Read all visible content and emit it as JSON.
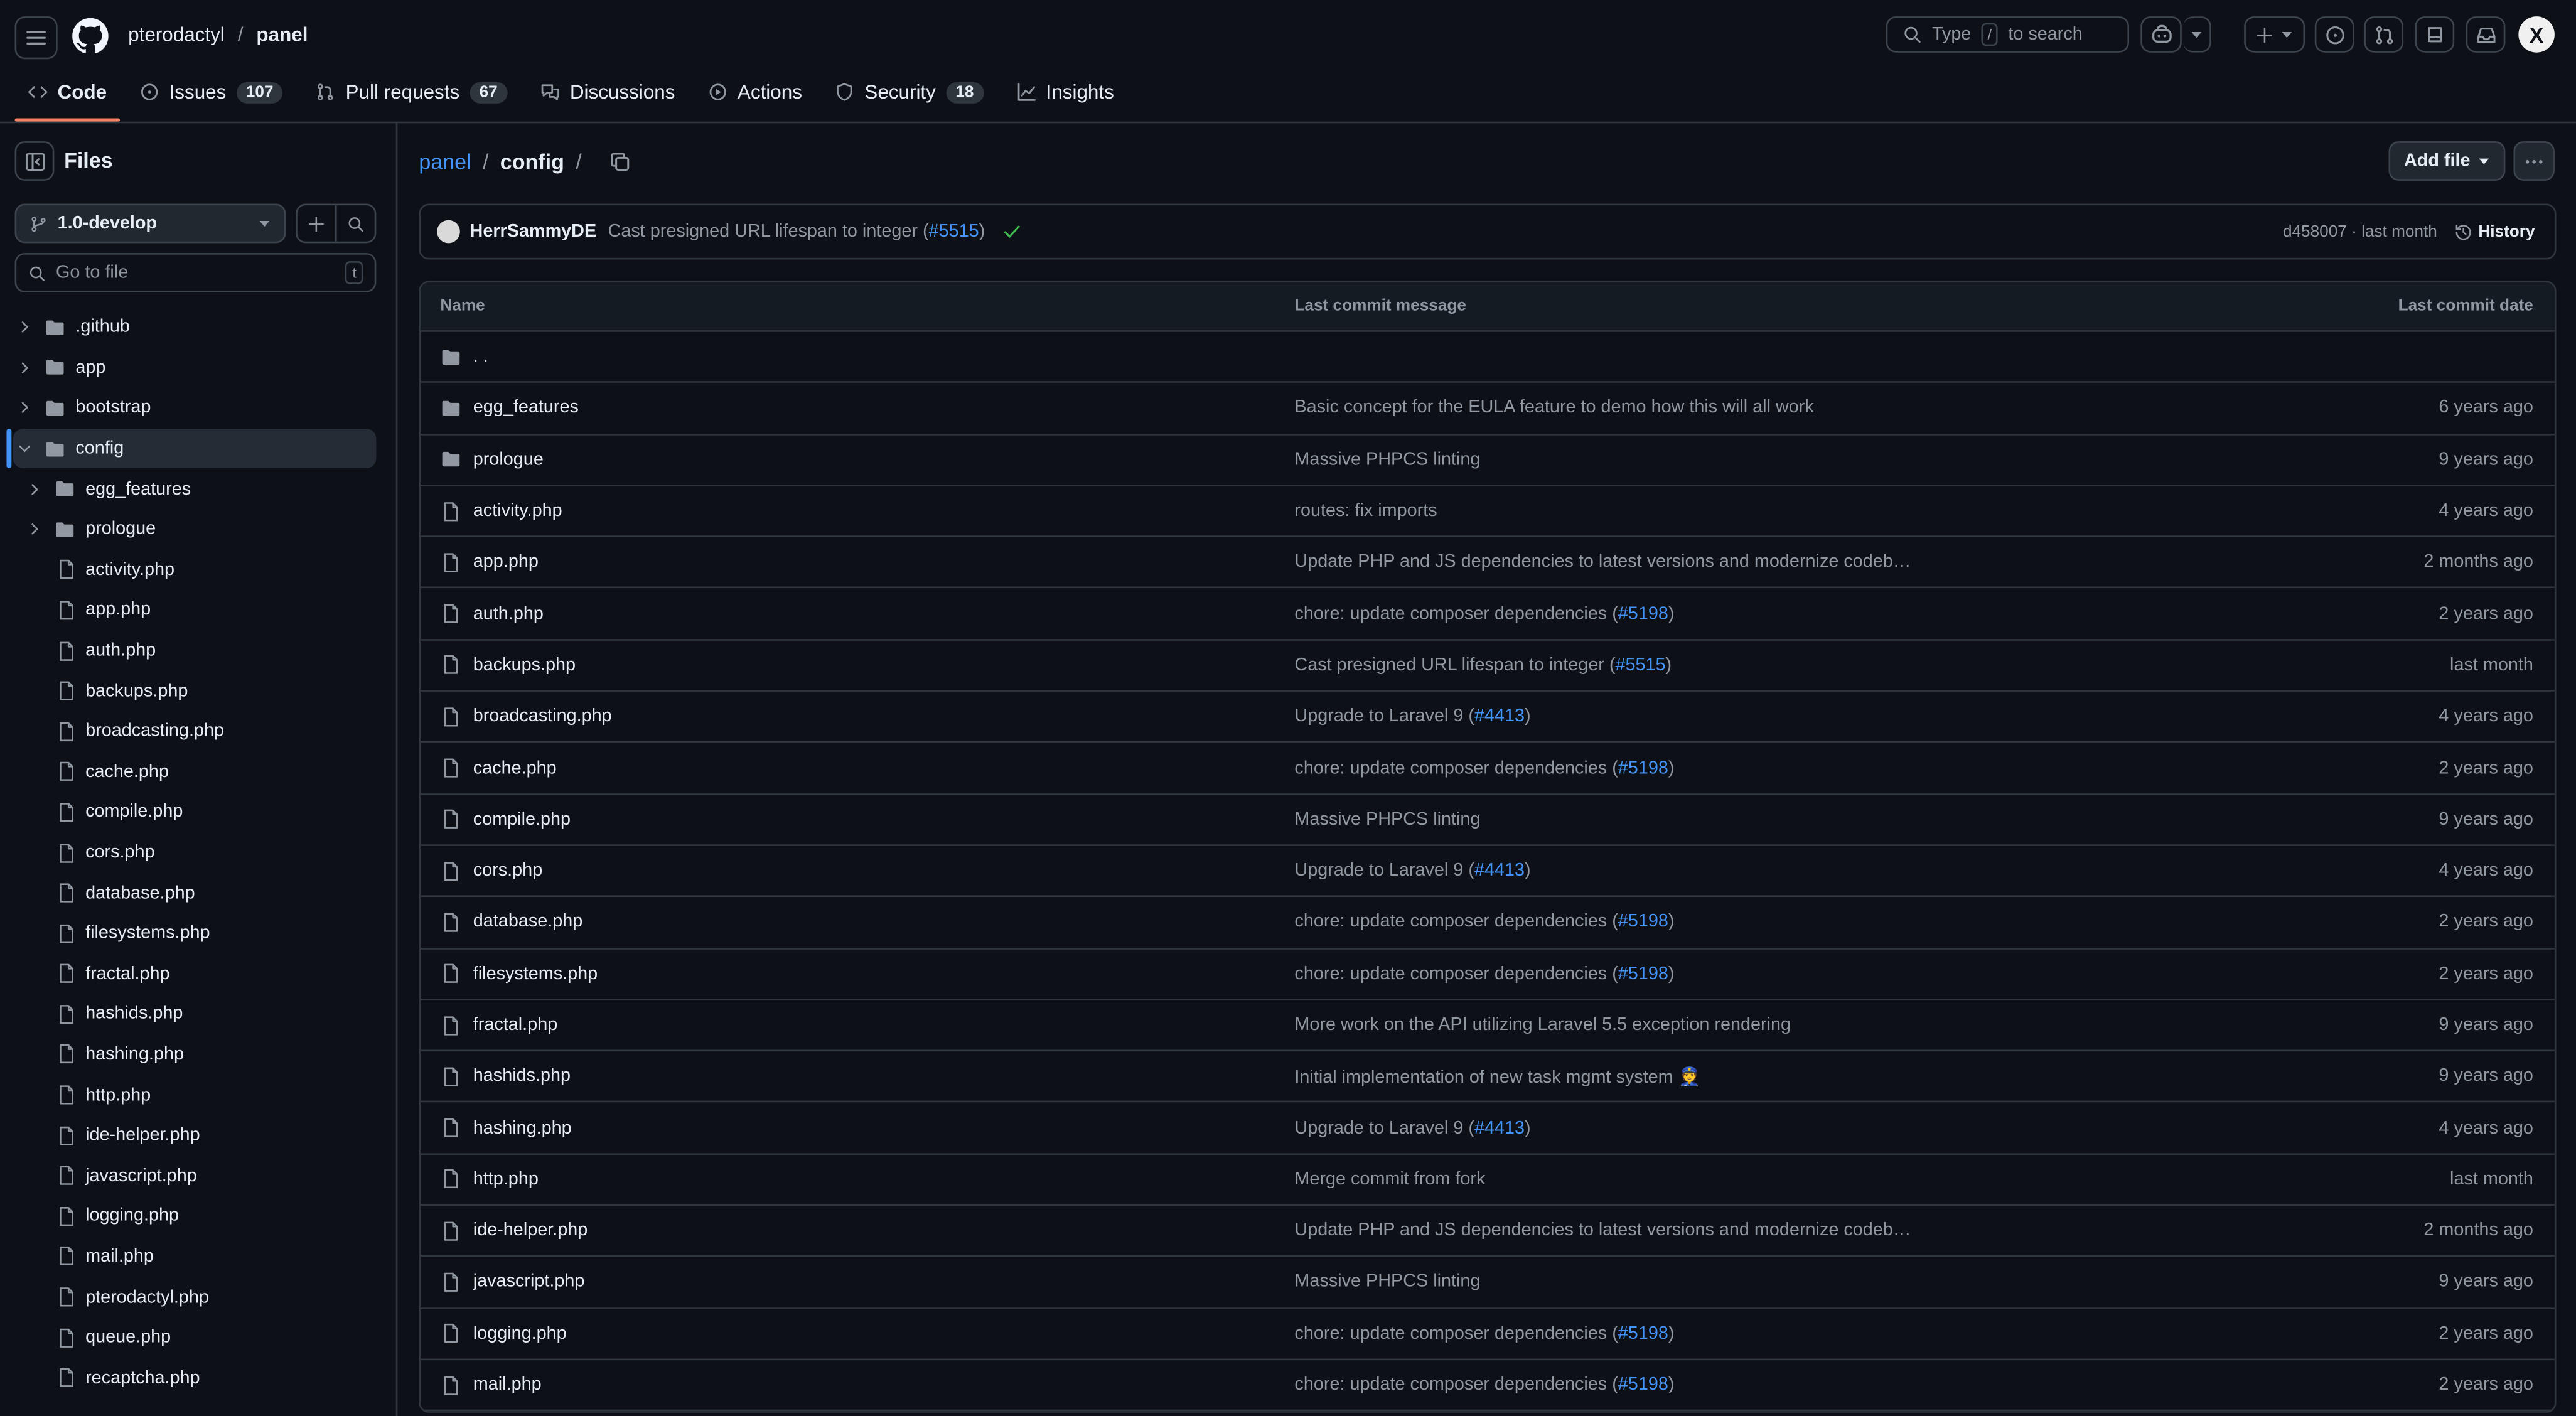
{
  "header": {
    "owner": "pterodactyl",
    "repo": "panel",
    "search_prefix": "Type",
    "search_key": "/",
    "search_suffix": "to search",
    "avatar_letter": "X"
  },
  "repo_tabs": [
    {
      "label": "Code",
      "count": ""
    },
    {
      "label": "Issues",
      "count": "107"
    },
    {
      "label": "Pull requests",
      "count": "67"
    },
    {
      "label": "Discussions",
      "count": ""
    },
    {
      "label": "Actions",
      "count": ""
    },
    {
      "label": "Security",
      "count": "18"
    },
    {
      "label": "Insights",
      "count": ""
    }
  ],
  "sidebar": {
    "title": "Files",
    "branch": "1.0-develop",
    "goto_placeholder": "Go to file",
    "goto_key": "t",
    "tree": [
      {
        "label": ".github",
        "type": "folder",
        "level": 0,
        "expanded": false
      },
      {
        "label": "app",
        "type": "folder",
        "level": 0,
        "expanded": false
      },
      {
        "label": "bootstrap",
        "type": "folder",
        "level": 0,
        "expanded": false
      },
      {
        "label": "config",
        "type": "folder",
        "level": 0,
        "expanded": true,
        "selected": true
      },
      {
        "label": "egg_features",
        "type": "folder",
        "level": 1,
        "expanded": false
      },
      {
        "label": "prologue",
        "type": "folder",
        "level": 1,
        "expanded": false
      },
      {
        "label": "activity.php",
        "type": "file",
        "level": 1
      },
      {
        "label": "app.php",
        "type": "file",
        "level": 1
      },
      {
        "label": "auth.php",
        "type": "file",
        "level": 1
      },
      {
        "label": "backups.php",
        "type": "file",
        "level": 1
      },
      {
        "label": "broadcasting.php",
        "type": "file",
        "level": 1
      },
      {
        "label": "cache.php",
        "type": "file",
        "level": 1
      },
      {
        "label": "compile.php",
        "type": "file",
        "level": 1
      },
      {
        "label": "cors.php",
        "type": "file",
        "level": 1
      },
      {
        "label": "database.php",
        "type": "file",
        "level": 1
      },
      {
        "label": "filesystems.php",
        "type": "file",
        "level": 1
      },
      {
        "label": "fractal.php",
        "type": "file",
        "level": 1
      },
      {
        "label": "hashids.php",
        "type": "file",
        "level": 1
      },
      {
        "label": "hashing.php",
        "type": "file",
        "level": 1
      },
      {
        "label": "http.php",
        "type": "file",
        "level": 1
      },
      {
        "label": "ide-helper.php",
        "type": "file",
        "level": 1
      },
      {
        "label": "javascript.php",
        "type": "file",
        "level": 1
      },
      {
        "label": "logging.php",
        "type": "file",
        "level": 1
      },
      {
        "label": "mail.php",
        "type": "file",
        "level": 1
      },
      {
        "label": "pterodactyl.php",
        "type": "file",
        "level": 1
      },
      {
        "label": "queue.php",
        "type": "file",
        "level": 1
      },
      {
        "label": "recaptcha.php",
        "type": "file",
        "level": 1
      }
    ]
  },
  "main": {
    "path_root": "panel",
    "path_current": "config",
    "add_file_label": "Add file",
    "commit": {
      "author": "HerrSammyDE",
      "message": "Cast presigned URL lifespan to integer (",
      "pr": "#5515",
      "message_end": ")",
      "sha": "d458007",
      "when": "last month",
      "history_label": "History"
    },
    "columns": {
      "name": "Name",
      "message": "Last commit message",
      "date": "Last commit date"
    },
    "parent_label": ". .",
    "rows": [
      {
        "name": "egg_features",
        "type": "folder",
        "msg": "Basic concept for the EULA feature to demo how this will all work",
        "pr": "",
        "msg_end": "",
        "date": "6 years ago"
      },
      {
        "name": "prologue",
        "type": "folder",
        "msg": "Massive PHPCS linting",
        "pr": "",
        "msg_end": "",
        "date": "9 years ago"
      },
      {
        "name": "activity.php",
        "type": "file",
        "msg": "routes: fix imports",
        "pr": "",
        "msg_end": "",
        "date": "4 years ago"
      },
      {
        "name": "app.php",
        "type": "file",
        "msg": "Update PHP and JS dependencies to latest versions and modernize codeb…",
        "pr": "",
        "msg_end": "",
        "date": "2 months ago"
      },
      {
        "name": "auth.php",
        "type": "file",
        "msg": "chore: update composer dependencies (",
        "pr": "#5198",
        "msg_end": ")",
        "date": "2 years ago"
      },
      {
        "name": "backups.php",
        "type": "file",
        "msg": "Cast presigned URL lifespan to integer (",
        "pr": "#5515",
        "msg_end": ")",
        "date": "last month"
      },
      {
        "name": "broadcasting.php",
        "type": "file",
        "msg": "Upgrade to Laravel 9 (",
        "pr": "#4413",
        "msg_end": ")",
        "date": "4 years ago"
      },
      {
        "name": "cache.php",
        "type": "file",
        "msg": "chore: update composer dependencies (",
        "pr": "#5198",
        "msg_end": ")",
        "date": "2 years ago"
      },
      {
        "name": "compile.php",
        "type": "file",
        "msg": "Massive PHPCS linting",
        "pr": "",
        "msg_end": "",
        "date": "9 years ago"
      },
      {
        "name": "cors.php",
        "type": "file",
        "msg": "Upgrade to Laravel 9 (",
        "pr": "#4413",
        "msg_end": ")",
        "date": "4 years ago"
      },
      {
        "name": "database.php",
        "type": "file",
        "msg": "chore: update composer dependencies (",
        "pr": "#5198",
        "msg_end": ")",
        "date": "2 years ago"
      },
      {
        "name": "filesystems.php",
        "type": "file",
        "msg": "chore: update composer dependencies (",
        "pr": "#5198",
        "msg_end": ")",
        "date": "2 years ago"
      },
      {
        "name": "fractal.php",
        "type": "file",
        "msg": "More work on the API utilizing Laravel 5.5 exception rendering",
        "pr": "",
        "msg_end": "",
        "date": "9 years ago"
      },
      {
        "name": "hashids.php",
        "type": "file",
        "msg": "Initial implementation of new task mgmt system 👮",
        "pr": "",
        "msg_end": "",
        "date": "9 years ago"
      },
      {
        "name": "hashing.php",
        "type": "file",
        "msg": "Upgrade to Laravel 9 (",
        "pr": "#4413",
        "msg_end": ")",
        "date": "4 years ago"
      },
      {
        "name": "http.php",
        "type": "file",
        "msg": "Merge commit from fork",
        "pr": "",
        "msg_end": "",
        "date": "last month"
      },
      {
        "name": "ide-helper.php",
        "type": "file",
        "msg": "Update PHP and JS dependencies to latest versions and modernize codeb…",
        "pr": "",
        "msg_end": "",
        "date": "2 months ago"
      },
      {
        "name": "javascript.php",
        "type": "file",
        "msg": "Massive PHPCS linting",
        "pr": "",
        "msg_end": "",
        "date": "9 years ago"
      },
      {
        "name": "logging.php",
        "type": "file",
        "msg": "chore: update composer dependencies (",
        "pr": "#5198",
        "msg_end": ")",
        "date": "2 years ago"
      },
      {
        "name": "mail.php",
        "type": "file",
        "msg": "chore: update composer dependencies (",
        "pr": "#5198",
        "msg_end": ")",
        "date": "2 years ago"
      }
    ]
  },
  "colors": {
    "bg": "#0d1117",
    "link": "#4493f8",
    "muted": "#9198a1",
    "tab_underline": "#f78166",
    "check": "#3fb950"
  }
}
